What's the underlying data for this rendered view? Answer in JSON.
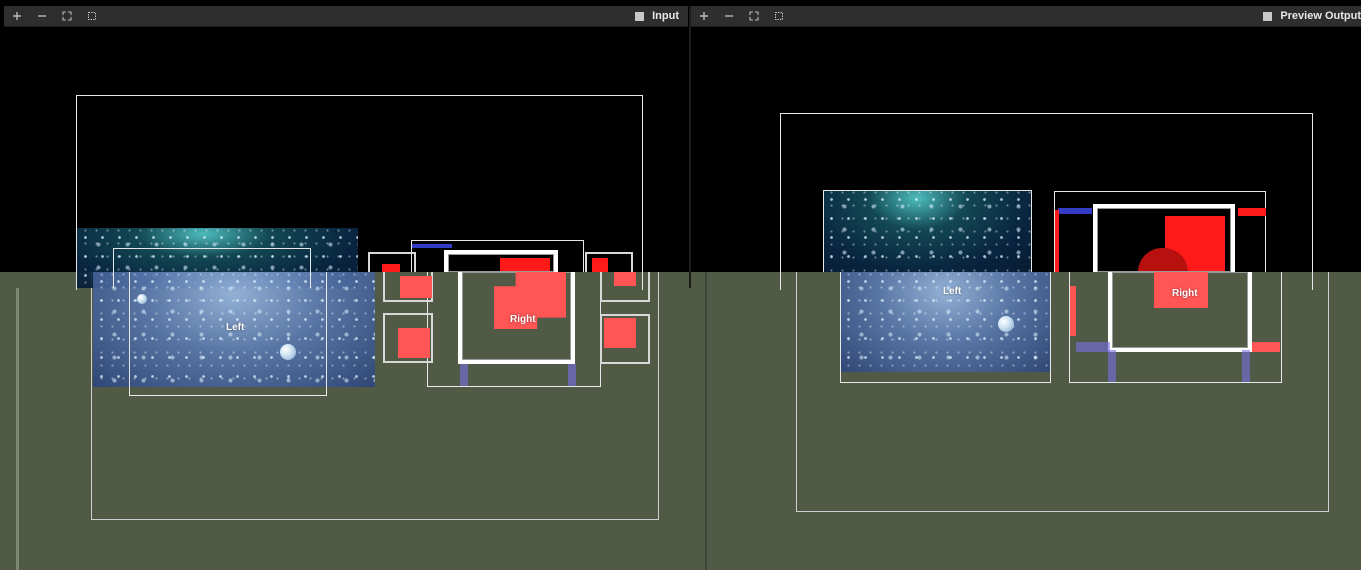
{
  "panels": {
    "input": {
      "title": "Input",
      "toolbar_icons": [
        "zoom-in-icon",
        "zoom-out-icon",
        "fit-icon",
        "actual-size-icon"
      ],
      "toolbar_glyphs": [
        "+",
        "−",
        "⤢",
        "⬚"
      ]
    },
    "preview": {
      "title": "Preview Output",
      "toolbar_icons": [
        "zoom-in-icon",
        "zoom-out-icon",
        "fit-icon",
        "actual-size-icon"
      ],
      "toolbar_glyphs": [
        "+",
        "−",
        "⤢",
        "⬚"
      ]
    }
  },
  "labels": {
    "left": "Left",
    "right": "Right"
  },
  "colors": {
    "background_green": "#505a44",
    "canvas_black": "#000000",
    "accent_red": "#ff1a1a",
    "accent_blue": "#3c46e6",
    "frame_white": "#e8e8e8"
  }
}
